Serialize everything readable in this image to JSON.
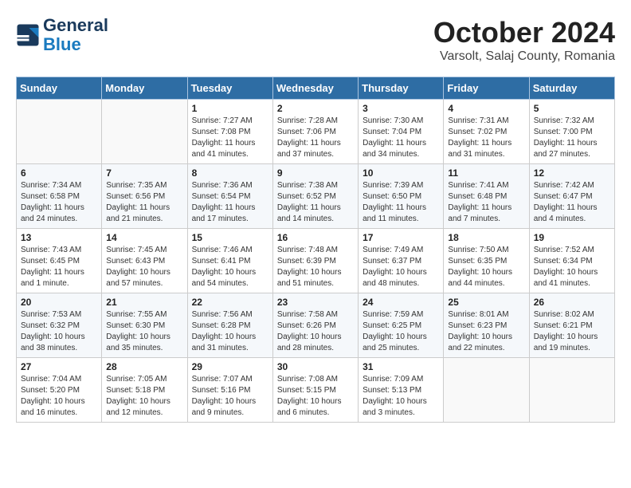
{
  "header": {
    "logo_line1": "General",
    "logo_line2": "Blue",
    "month_title": "October 2024",
    "location": "Varsolt, Salaj County, Romania"
  },
  "weekdays": [
    "Sunday",
    "Monday",
    "Tuesday",
    "Wednesday",
    "Thursday",
    "Friday",
    "Saturday"
  ],
  "weeks": [
    [
      {
        "day": "",
        "info": ""
      },
      {
        "day": "",
        "info": ""
      },
      {
        "day": "1",
        "info": "Sunrise: 7:27 AM\nSunset: 7:08 PM\nDaylight: 11 hours and 41 minutes."
      },
      {
        "day": "2",
        "info": "Sunrise: 7:28 AM\nSunset: 7:06 PM\nDaylight: 11 hours and 37 minutes."
      },
      {
        "day": "3",
        "info": "Sunrise: 7:30 AM\nSunset: 7:04 PM\nDaylight: 11 hours and 34 minutes."
      },
      {
        "day": "4",
        "info": "Sunrise: 7:31 AM\nSunset: 7:02 PM\nDaylight: 11 hours and 31 minutes."
      },
      {
        "day": "5",
        "info": "Sunrise: 7:32 AM\nSunset: 7:00 PM\nDaylight: 11 hours and 27 minutes."
      }
    ],
    [
      {
        "day": "6",
        "info": "Sunrise: 7:34 AM\nSunset: 6:58 PM\nDaylight: 11 hours and 24 minutes."
      },
      {
        "day": "7",
        "info": "Sunrise: 7:35 AM\nSunset: 6:56 PM\nDaylight: 11 hours and 21 minutes."
      },
      {
        "day": "8",
        "info": "Sunrise: 7:36 AM\nSunset: 6:54 PM\nDaylight: 11 hours and 17 minutes."
      },
      {
        "day": "9",
        "info": "Sunrise: 7:38 AM\nSunset: 6:52 PM\nDaylight: 11 hours and 14 minutes."
      },
      {
        "day": "10",
        "info": "Sunrise: 7:39 AM\nSunset: 6:50 PM\nDaylight: 11 hours and 11 minutes."
      },
      {
        "day": "11",
        "info": "Sunrise: 7:41 AM\nSunset: 6:48 PM\nDaylight: 11 hours and 7 minutes."
      },
      {
        "day": "12",
        "info": "Sunrise: 7:42 AM\nSunset: 6:47 PM\nDaylight: 11 hours and 4 minutes."
      }
    ],
    [
      {
        "day": "13",
        "info": "Sunrise: 7:43 AM\nSunset: 6:45 PM\nDaylight: 11 hours and 1 minute."
      },
      {
        "day": "14",
        "info": "Sunrise: 7:45 AM\nSunset: 6:43 PM\nDaylight: 10 hours and 57 minutes."
      },
      {
        "day": "15",
        "info": "Sunrise: 7:46 AM\nSunset: 6:41 PM\nDaylight: 10 hours and 54 minutes."
      },
      {
        "day": "16",
        "info": "Sunrise: 7:48 AM\nSunset: 6:39 PM\nDaylight: 10 hours and 51 minutes."
      },
      {
        "day": "17",
        "info": "Sunrise: 7:49 AM\nSunset: 6:37 PM\nDaylight: 10 hours and 48 minutes."
      },
      {
        "day": "18",
        "info": "Sunrise: 7:50 AM\nSunset: 6:35 PM\nDaylight: 10 hours and 44 minutes."
      },
      {
        "day": "19",
        "info": "Sunrise: 7:52 AM\nSunset: 6:34 PM\nDaylight: 10 hours and 41 minutes."
      }
    ],
    [
      {
        "day": "20",
        "info": "Sunrise: 7:53 AM\nSunset: 6:32 PM\nDaylight: 10 hours and 38 minutes."
      },
      {
        "day": "21",
        "info": "Sunrise: 7:55 AM\nSunset: 6:30 PM\nDaylight: 10 hours and 35 minutes."
      },
      {
        "day": "22",
        "info": "Sunrise: 7:56 AM\nSunset: 6:28 PM\nDaylight: 10 hours and 31 minutes."
      },
      {
        "day": "23",
        "info": "Sunrise: 7:58 AM\nSunset: 6:26 PM\nDaylight: 10 hours and 28 minutes."
      },
      {
        "day": "24",
        "info": "Sunrise: 7:59 AM\nSunset: 6:25 PM\nDaylight: 10 hours and 25 minutes."
      },
      {
        "day": "25",
        "info": "Sunrise: 8:01 AM\nSunset: 6:23 PM\nDaylight: 10 hours and 22 minutes."
      },
      {
        "day": "26",
        "info": "Sunrise: 8:02 AM\nSunset: 6:21 PM\nDaylight: 10 hours and 19 minutes."
      }
    ],
    [
      {
        "day": "27",
        "info": "Sunrise: 7:04 AM\nSunset: 5:20 PM\nDaylight: 10 hours and 16 minutes."
      },
      {
        "day": "28",
        "info": "Sunrise: 7:05 AM\nSunset: 5:18 PM\nDaylight: 10 hours and 12 minutes."
      },
      {
        "day": "29",
        "info": "Sunrise: 7:07 AM\nSunset: 5:16 PM\nDaylight: 10 hours and 9 minutes."
      },
      {
        "day": "30",
        "info": "Sunrise: 7:08 AM\nSunset: 5:15 PM\nDaylight: 10 hours and 6 minutes."
      },
      {
        "day": "31",
        "info": "Sunrise: 7:09 AM\nSunset: 5:13 PM\nDaylight: 10 hours and 3 minutes."
      },
      {
        "day": "",
        "info": ""
      },
      {
        "day": "",
        "info": ""
      }
    ]
  ]
}
